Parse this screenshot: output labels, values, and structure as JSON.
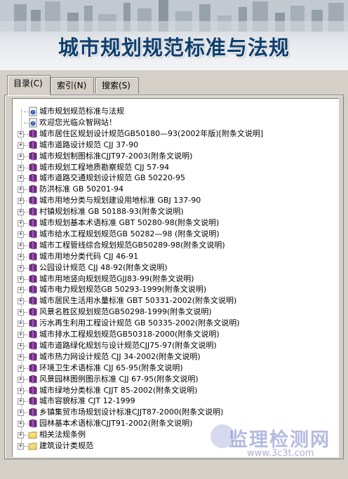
{
  "banner": {
    "title": "城市规划规范标准与法规"
  },
  "tabs": [
    {
      "label": "目录(C)",
      "active": true
    },
    {
      "label": "索引(N)",
      "active": false
    },
    {
      "label": "搜索(S)",
      "active": false
    }
  ],
  "tree": [
    {
      "label": "城市规划规范标准与法规",
      "icon": "help-page-icon",
      "expander": false
    },
    {
      "label": "欢迎您光临众智网站！",
      "icon": "help-page-icon",
      "expander": false
    },
    {
      "label": "城市居住区规划设计规范GB50180—93(2002年版)[附条文说明]",
      "icon": "book-icon",
      "expander": true
    },
    {
      "label": "城市道路设计规范 CJJ 37-90",
      "icon": "book-icon",
      "expander": true
    },
    {
      "label": "城市规划制图标准CJJT97-2003(附条文说明)",
      "icon": "book-icon",
      "expander": true
    },
    {
      "label": "城市规划工程地质勘察规范 CJJ 57-94",
      "icon": "book-icon",
      "expander": true
    },
    {
      "label": "城市道路交通规划设计规范 GB 50220-95",
      "icon": "book-icon",
      "expander": true
    },
    {
      "label": "防洪标准 GB 50201-94",
      "icon": "book-icon",
      "expander": true
    },
    {
      "label": "城市用地分类与规划建设用地标准 GBJ 137-90",
      "icon": "book-icon",
      "expander": true
    },
    {
      "label": "村镇规划标准 GB 50188-93(附条文说明)",
      "icon": "book-icon",
      "expander": true
    },
    {
      "label": "城市规划基本术语标准 GBT 50280-98(附条文说明)",
      "icon": "book-icon",
      "expander": true
    },
    {
      "label": "城市给水工程规划规范GB 50282—98 (附条文说明)",
      "icon": "book-icon",
      "expander": true
    },
    {
      "label": "城市工程管线综合规划规范GB50289-98(附条文说明)",
      "icon": "book-icon",
      "expander": true
    },
    {
      "label": "城市用地分类代码 CJJ 46-91",
      "icon": "book-icon",
      "expander": true
    },
    {
      "label": "公园设计规范 CJJ 48-92(附条文说明)",
      "icon": "book-icon",
      "expander": true
    },
    {
      "label": "城市用地竖向规划规范GJJ83-99(附条文说明)",
      "icon": "book-icon",
      "expander": true
    },
    {
      "label": "城市电力规划规范GB 50293-1999(附条文说明)",
      "icon": "book-icon",
      "expander": true
    },
    {
      "label": "城市居民生活用水量标准 GBT 50331-2002(附条文说明)",
      "icon": "book-icon",
      "expander": true
    },
    {
      "label": "风景名胜区规划规范GB50298-1999(附条文说明)",
      "icon": "book-icon",
      "expander": true
    },
    {
      "label": "污水再生利用工程设计规范 GB 50335-2002(附条文说明)",
      "icon": "book-icon",
      "expander": true
    },
    {
      "label": "城市排水工程规划规范GB50318-2000(附条文说明)",
      "icon": "book-icon",
      "expander": true
    },
    {
      "label": "城市道路绿化规划与设计规范CJJ75-97(附条文说明)",
      "icon": "book-icon",
      "expander": true
    },
    {
      "label": "城市热力网设计规范 CJJ 34-2002(附条文说明)",
      "icon": "book-icon",
      "expander": true
    },
    {
      "label": "环境卫生术语标准 CJJ 65-95(附条文说明)",
      "icon": "book-icon",
      "expander": true
    },
    {
      "label": "风景园林图例图示标准 CJJ 67-95(附条文说明)",
      "icon": "book-icon",
      "expander": true
    },
    {
      "label": "城市绿地分类标准 CJJT 85-2002(附条文说明)",
      "icon": "book-icon",
      "expander": true
    },
    {
      "label": "城市容貌标准 CJT 12-1999",
      "icon": "book-icon",
      "expander": true
    },
    {
      "label": "乡镇集贸市场规划设计标准CJJT87-2000(附条文说明)",
      "icon": "book-icon",
      "expander": true
    },
    {
      "label": "园林基本术语标准CJJT91-2002(附条文说明)",
      "icon": "book-icon",
      "expander": true
    },
    {
      "label": "相关法规条例",
      "icon": "folder-icon",
      "expander": true
    },
    {
      "label": "建筑设计类规范",
      "icon": "folder-icon",
      "expander": true
    }
  ],
  "watermark": {
    "title": "监理检测网",
    "url": "www.3c3t.com"
  },
  "colors": {
    "title": "#0f3f6e",
    "book": "#7a2a8c",
    "folder": "#f1d66b",
    "help": "#2a56b8"
  }
}
